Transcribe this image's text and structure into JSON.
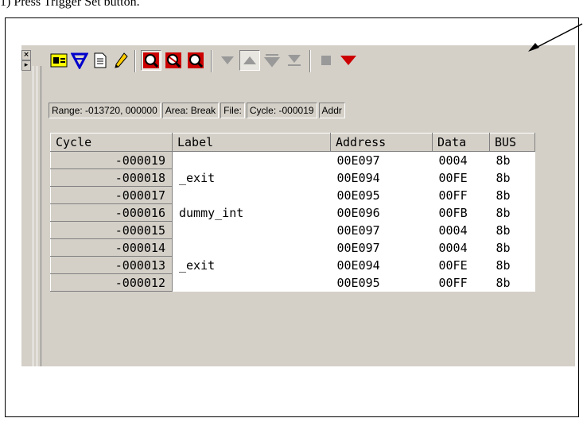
{
  "top_text": "1) Press Trigger Set button.",
  "side": {
    "close_glyph": "×",
    "expand_glyph": "▸"
  },
  "toolbar": {
    "icons": [
      "format-icon",
      "filter-icon",
      "document-icon",
      "pencil-icon",
      "trace-on-icon",
      "trace-off-icon",
      "trace-search-icon",
      "move-down-icon",
      "move-up-icon",
      "jump-down-icon",
      "jump-bottom-icon",
      "stop-icon",
      "trigger-set-icon"
    ]
  },
  "status_bar": [
    "Range: -013720, 000000",
    "Area: Break",
    "File:",
    "Cycle: -000019",
    "Addr"
  ],
  "table": {
    "columns": [
      "Cycle",
      "Label",
      "Address",
      "Data",
      "BUS"
    ],
    "rows": [
      [
        "-000019",
        "",
        "00E097",
        "0004",
        "8b"
      ],
      [
        "-000018",
        "_exit",
        "00E094",
        "00FE",
        "8b"
      ],
      [
        "-000017",
        "",
        "00E095",
        "00FF",
        "8b"
      ],
      [
        "-000016",
        "dummy_int",
        "00E096",
        "00FB",
        "8b"
      ],
      [
        "-000015",
        "",
        "00E097",
        "0004",
        "8b"
      ],
      [
        "-000014",
        "",
        "00E097",
        "0004",
        "8b"
      ],
      [
        "-000013",
        "_exit",
        "00E094",
        "00FE",
        "8b"
      ],
      [
        "-000012",
        "",
        "00E095",
        "00FF",
        "8b"
      ]
    ]
  },
  "colors": {
    "window": "#d4d0c8",
    "accent_red": "#cc0000",
    "blue": "#0000cc"
  }
}
